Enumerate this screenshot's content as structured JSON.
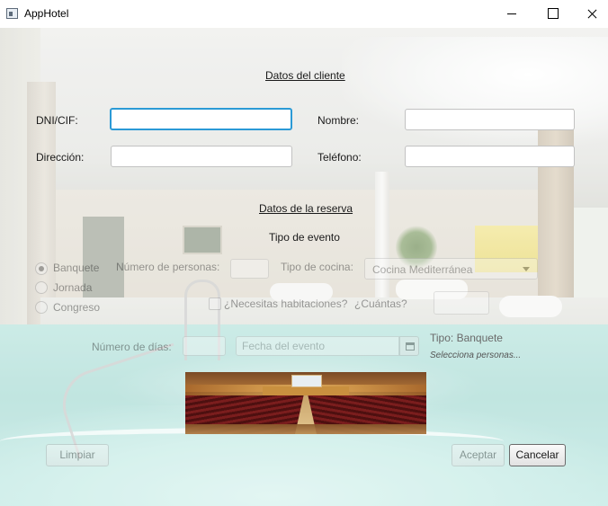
{
  "window": {
    "title": "AppHotel"
  },
  "client_section": {
    "title": "Datos del cliente",
    "dni_label": "DNI/CIF:",
    "dni_value": "",
    "nombre_label": "Nombre:",
    "nombre_value": "",
    "direccion_label": "Dirección:",
    "direccion_value": "",
    "telefono_label": "Teléfono:",
    "telefono_value": ""
  },
  "booking_section": {
    "title": "Datos de la reserva",
    "event_type_title": "Tipo de evento",
    "event_types": [
      {
        "label": "Banquete",
        "selected": true
      },
      {
        "label": "Jornada",
        "selected": false
      },
      {
        "label": "Congreso",
        "selected": false
      }
    ],
    "personas_label": "Número de personas:",
    "personas_value": "",
    "cocina_label": "Tipo de cocina:",
    "cocina_selected": "Cocina Mediterránea",
    "habitaciones_label": "¿Necesitas habitaciones?",
    "habitaciones_checked": false,
    "cuantas_label": "¿Cuántas?",
    "cuantas_value": "",
    "dias_label": "Número de días:",
    "dias_value": "",
    "fecha_placeholder": "Fecha del evento",
    "calendar_icon": "calendar-icon",
    "tipo_info": "Tipo: Banquete",
    "tipo_hint": "Selecciona personas..."
  },
  "buttons": {
    "limpiar": "Limpiar",
    "aceptar": "Aceptar",
    "cancelar": "Cancelar"
  },
  "colors": {
    "focus_ring": "#2b9ad6"
  }
}
